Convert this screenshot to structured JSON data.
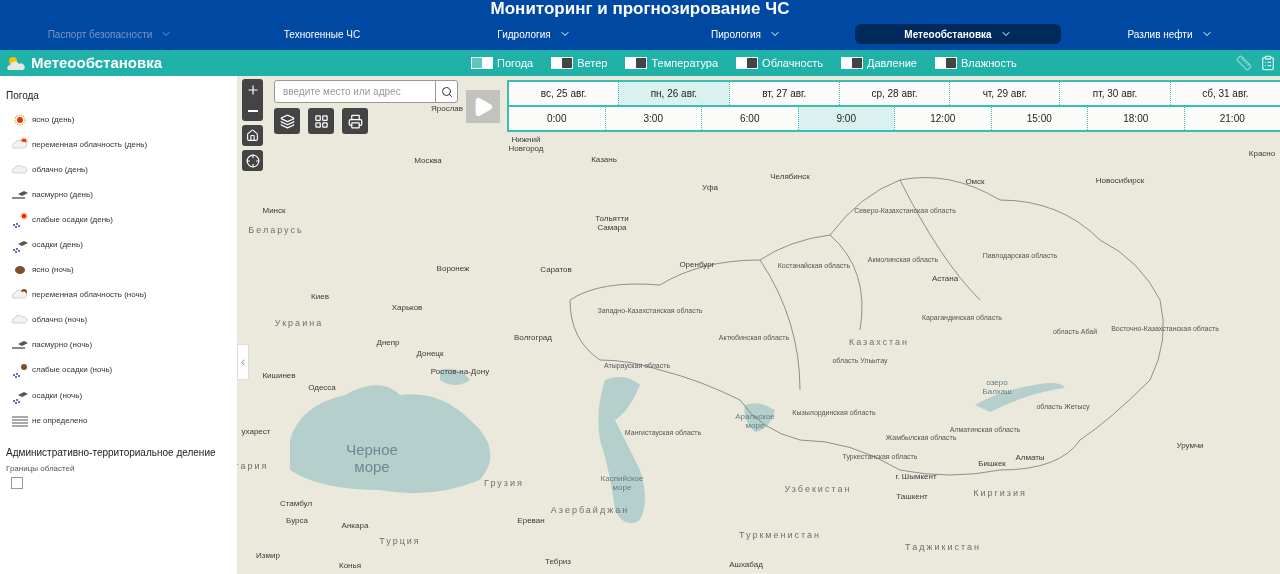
{
  "header": {
    "title": "Мониторинг и прогнозирование ЧС"
  },
  "nav": [
    {
      "label": "Паспорт безопасности",
      "selected": false,
      "disabled": true,
      "has_menu": true
    },
    {
      "label": "Техногенные ЧС",
      "selected": false,
      "disabled": false,
      "has_menu": false
    },
    {
      "label": "Гидрология",
      "selected": false,
      "disabled": false,
      "has_menu": true
    },
    {
      "label": "Пирология",
      "selected": false,
      "disabled": false,
      "has_menu": true
    },
    {
      "label": "Метеообстановка",
      "selected": true,
      "disabled": false,
      "has_menu": true
    },
    {
      "label": "Разлив нефти",
      "selected": false,
      "disabled": false,
      "has_menu": true
    }
  ],
  "toolbar": {
    "title": "Метеообстановка",
    "layers": [
      {
        "label": "Погода",
        "on": true
      },
      {
        "label": "Ветер",
        "on": false
      },
      {
        "label": "Температура",
        "on": false
      },
      {
        "label": "Облачность",
        "on": false
      },
      {
        "label": "Давление",
        "on": false
      },
      {
        "label": "Влажность",
        "on": false
      }
    ]
  },
  "sidebar": {
    "legend_title": "Погода",
    "legend": [
      {
        "label": "ясно (день)",
        "kind": "sun"
      },
      {
        "label": "переменная облачность (день)",
        "kind": "cloudsun"
      },
      {
        "label": "облачно (день)",
        "kind": "cloud"
      },
      {
        "label": "пасмурно (день)",
        "kind": "overcast"
      },
      {
        "label": "слабые осадки (день)",
        "kind": "rainsun"
      },
      {
        "label": "осадки (день)",
        "kind": "rain"
      },
      {
        "label": "ясно (ночь)",
        "kind": "moon"
      },
      {
        "label": "переменная облачность (ночь)",
        "kind": "cloudmoon"
      },
      {
        "label": "облачно (ночь)",
        "kind": "cloud"
      },
      {
        "label": "пасмурно (ночь)",
        "kind": "overcast"
      },
      {
        "label": "слабые осадки (ночь)",
        "kind": "rainmoon"
      },
      {
        "label": "осадки (ночь)",
        "kind": "rain"
      },
      {
        "label": "не определено",
        "kind": "fog"
      }
    ],
    "admin_title": "Административно-территориальное деление",
    "admin_layer": {
      "label": "Границы областей",
      "checked": false
    }
  },
  "search": {
    "placeholder": "введите место или адрес"
  },
  "timeline": {
    "days": [
      {
        "label": "вс, 25 авг.",
        "selected": false
      },
      {
        "label": "пн, 26 авг.",
        "selected": true
      },
      {
        "label": "вт, 27 авг.",
        "selected": false
      },
      {
        "label": "ср, 28 авг.",
        "selected": false
      },
      {
        "label": "чт, 29 авг.",
        "selected": false
      },
      {
        "label": "пт, 30 авг.",
        "selected": false
      },
      {
        "label": "сб, 31 авг.",
        "selected": false
      }
    ],
    "times": [
      {
        "label": "0:00",
        "selected": false
      },
      {
        "label": "3:00",
        "selected": false
      },
      {
        "label": "6:00",
        "selected": false
      },
      {
        "label": "9:00",
        "selected": true
      },
      {
        "label": "12:00",
        "selected": false
      },
      {
        "label": "15:00",
        "selected": false
      },
      {
        "label": "18:00",
        "selected": false
      },
      {
        "label": "21:00",
        "selected": false
      }
    ]
  },
  "map": {
    "labels": [
      {
        "text": "Ярослав",
        "kind": "city"
      },
      {
        "text": "Нижний Новгород",
        "kind": "city"
      },
      {
        "text": "Москва",
        "kind": "city"
      },
      {
        "text": "Казань",
        "kind": "city"
      },
      {
        "text": "Уфа",
        "kind": "city"
      },
      {
        "text": "Челябинск",
        "kind": "city"
      },
      {
        "text": "Омск",
        "kind": "city"
      },
      {
        "text": "Новосибирск",
        "kind": "city"
      },
      {
        "text": "Минск",
        "kind": "city"
      },
      {
        "text": "Беларусь",
        "kind": "country"
      },
      {
        "text": "Тольятти Самара",
        "kind": "city"
      },
      {
        "text": "Северо-Казахстанская область",
        "kind": "region"
      },
      {
        "text": "Акмолинская область",
        "kind": "region"
      },
      {
        "text": "Павлодарская область",
        "kind": "region"
      },
      {
        "text": "Костанайская область",
        "kind": "region"
      },
      {
        "text": "Воронеж",
        "kind": "city"
      },
      {
        "text": "Саратов",
        "kind": "city"
      },
      {
        "text": "Оренбург",
        "kind": "city"
      },
      {
        "text": "Астана",
        "kind": "city"
      },
      {
        "text": "Киев",
        "kind": "city"
      },
      {
        "text": "Украина",
        "kind": "country"
      },
      {
        "text": "Харьков",
        "kind": "city"
      },
      {
        "text": "Западно-Казахстанская область",
        "kind": "region"
      },
      {
        "text": "Карагандинская область",
        "kind": "region"
      },
      {
        "text": "Актюбинская область",
        "kind": "region"
      },
      {
        "text": "Днепр",
        "kind": "city"
      },
      {
        "text": "Волгоград",
        "kind": "city"
      },
      {
        "text": "Донецк",
        "kind": "city"
      },
      {
        "text": "Казахстан",
        "kind": "country"
      },
      {
        "text": "область Ульытау",
        "kind": "region"
      },
      {
        "text": "область Абай",
        "kind": "region"
      },
      {
        "text": "Восточно-Казахстанская область",
        "kind": "region"
      },
      {
        "text": "Кишинев",
        "kind": "city"
      },
      {
        "text": "Ростов-на-Дону",
        "kind": "city"
      },
      {
        "text": "Атырауская область",
        "kind": "region"
      },
      {
        "text": "Одесса",
        "kind": "city"
      },
      {
        "text": "Кызылординская область",
        "kind": "region"
      },
      {
        "text": "Аральское море",
        "kind": "lake"
      },
      {
        "text": "озеро Балхаш",
        "kind": "lake"
      },
      {
        "text": "область Жетысу",
        "kind": "region"
      },
      {
        "text": "ухарест",
        "kind": "city"
      },
      {
        "text": "Мангистауская область",
        "kind": "region"
      },
      {
        "text": "Черное море",
        "kind": "sea"
      },
      {
        "text": "Жамбылская область",
        "kind": "region"
      },
      {
        "text": "Алматинская область",
        "kind": "region"
      },
      {
        "text": "Урумчи",
        "kind": "city"
      },
      {
        "text": "Туркестанская область",
        "kind": "region"
      },
      {
        "text": "Алматы",
        "kind": "city"
      },
      {
        "text": "Каспийское море",
        "kind": "lake"
      },
      {
        "text": "г. Шымкент",
        "kind": "city"
      },
      {
        "text": "Бишкек",
        "kind": "city"
      },
      {
        "text": "Грузия",
        "kind": "country"
      },
      {
        "text": "Узбекистан",
        "kind": "country"
      },
      {
        "text": "Киргизия",
        "kind": "country"
      },
      {
        "text": "Ташкент",
        "kind": "city"
      },
      {
        "text": "Стамбул",
        "kind": "city"
      },
      {
        "text": "Бурса",
        "kind": "city"
      },
      {
        "text": "Анкара",
        "kind": "city"
      },
      {
        "text": "Ереван",
        "kind": "city"
      },
      {
        "text": "Азербайджан",
        "kind": "country"
      },
      {
        "text": "Туркменистан",
        "kind": "country"
      },
      {
        "text": "Турция",
        "kind": "country"
      },
      {
        "text": "Таджикистан",
        "kind": "country"
      },
      {
        "text": "Измир",
        "kind": "city"
      },
      {
        "text": "Конья",
        "kind": "city"
      },
      {
        "text": "Тебриз",
        "kind": "city"
      },
      {
        "text": "Ашхабад",
        "kind": "city"
      },
      {
        "text": "гария",
        "kind": "country"
      },
      {
        "text": "Красно",
        "kind": "city"
      }
    ]
  }
}
